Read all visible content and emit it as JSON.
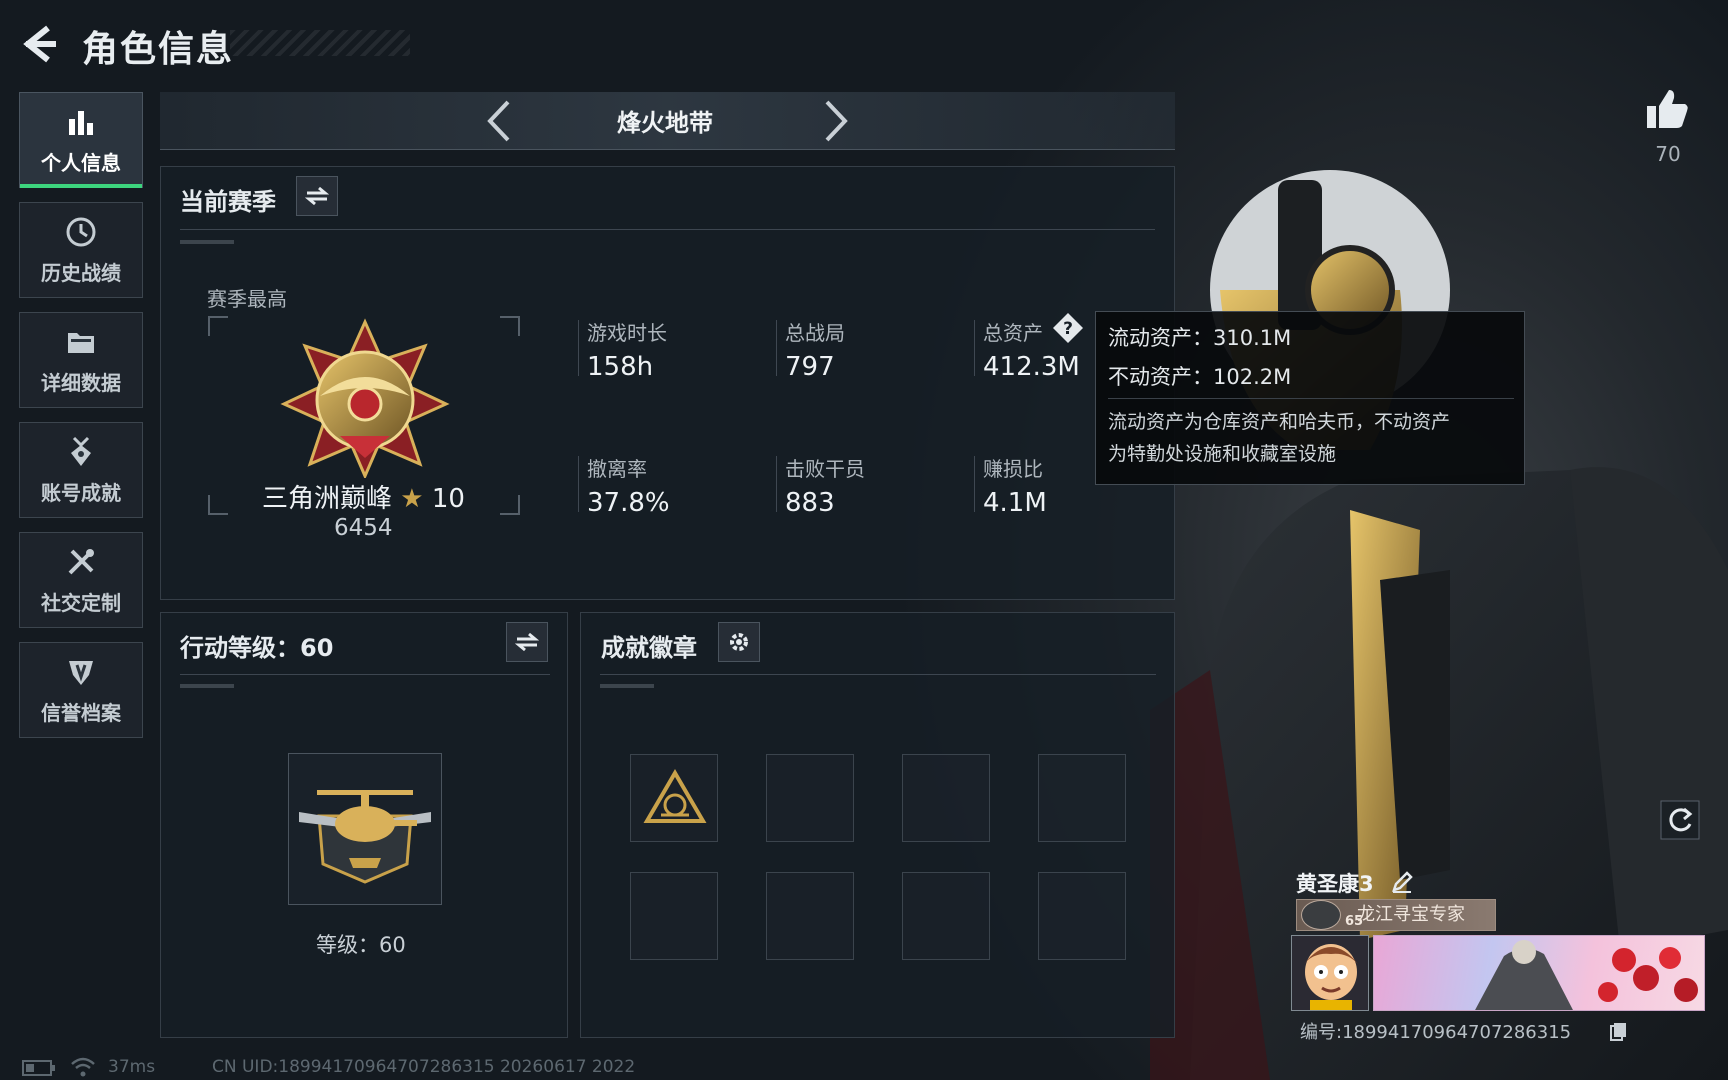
{
  "header": {
    "title": "角色信息"
  },
  "sidebar": {
    "items": [
      {
        "label": "个人信息",
        "icon": "bar-chart-icon",
        "active": true
      },
      {
        "label": "历史战绩",
        "icon": "clock-icon",
        "active": false
      },
      {
        "label": "详细数据",
        "icon": "folder-icon",
        "active": false
      },
      {
        "label": "账号成就",
        "icon": "medal-icon",
        "active": false
      },
      {
        "label": "社交定制",
        "icon": "tools-icon",
        "active": false
      },
      {
        "label": "信誉档案",
        "icon": "shield-icon",
        "active": false
      }
    ]
  },
  "mode": {
    "title": "烽火地带"
  },
  "season": {
    "heading": "当前赛季",
    "best_label": "赛季最高",
    "rank_name": "三角洲巅峰",
    "rank_stars": "10",
    "rank_points": "6454",
    "stats": [
      {
        "label": "游戏时长",
        "value": "158h"
      },
      {
        "label": "总战局",
        "value": "797"
      },
      {
        "label": "总资产",
        "value": "412.3M"
      },
      {
        "label": "撤离率",
        "value": "37.8%"
      },
      {
        "label": "击败干员",
        "value": "883"
      },
      {
        "label": "赚损比",
        "value": "4.1M"
      }
    ]
  },
  "tooltip": {
    "liquid": "流动资产：310.1M",
    "fixed": "不动资产：102.2M",
    "desc_line1": "流动资产为仓库资产和哈夫币，不动资产",
    "desc_line2": "为特勤处设施和收藏室设施"
  },
  "action_level": {
    "heading": "行动等级：60",
    "level_text": "等级：60"
  },
  "badges": {
    "heading": "成就徽章",
    "slots": 8,
    "filled": 1
  },
  "profile": {
    "likes": "70",
    "player_name": "黄圣康3",
    "title_tag": "龙江寻宝专家",
    "tag_level": "65",
    "id_line": "编号:18994170964707286315"
  },
  "status_bar": {
    "ping": "37ms",
    "uid": "CN UID:18994170964707286315 20260617 2022"
  },
  "colors": {
    "accent_green": "#3dd57e",
    "gold": "#c9a24a",
    "panel_bg": "#161e26"
  }
}
